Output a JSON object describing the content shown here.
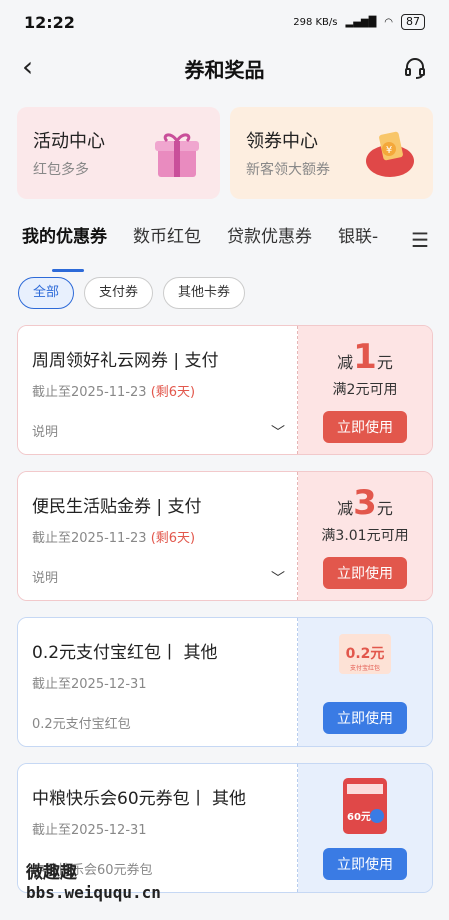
{
  "status": {
    "time": "12:22",
    "net": "298 KB/s",
    "battery": "87"
  },
  "header": {
    "title": "券和奖品"
  },
  "promo": [
    {
      "title": "活动中心",
      "sub": "红包多多"
    },
    {
      "title": "领券中心",
      "sub": "新客领大额券"
    }
  ],
  "tabs": [
    "我的优惠券",
    "数币红包",
    "贷款优惠券",
    "银联-"
  ],
  "filters": [
    "全部",
    "支付券",
    "其他卡券"
  ],
  "coupons": [
    {
      "name": "周周领好礼云网券 | 支付",
      "date": "截止至2025-11-23",
      "remain": "(剩6天)",
      "desc": "说明",
      "prefix": "减",
      "amount": "1",
      "unit": "元",
      "cond": "满2元可用",
      "btn": "立即使用"
    },
    {
      "name": "便民生活贴金券 | 支付",
      "date": "截止至2025-11-23",
      "remain": "(剩6天)",
      "desc": "说明",
      "prefix": "减",
      "amount": "3",
      "unit": "元",
      "cond": "满3.01元可用",
      "btn": "立即使用"
    },
    {
      "name": "0.2元支付宝红包丨 其他",
      "date": "截止至2025-12-31",
      "desc": "0.2元支付宝红包",
      "thumb": "0.2元",
      "thumb_sub": "支付宝红包",
      "btn": "立即使用"
    },
    {
      "name": "中粮快乐会60元券包丨 其他",
      "date": "截止至2025-12-31",
      "desc": "中粮快乐会60元券包",
      "thumb": "60元",
      "btn": "立即使用"
    }
  ],
  "watermark": {
    "line1": "微趣趣",
    "line2": "bbs.weiququ.cn"
  },
  "colors": {
    "accent": "#2d6ad8",
    "red": "#e2574c",
    "blue_btn": "#3a7be4"
  }
}
